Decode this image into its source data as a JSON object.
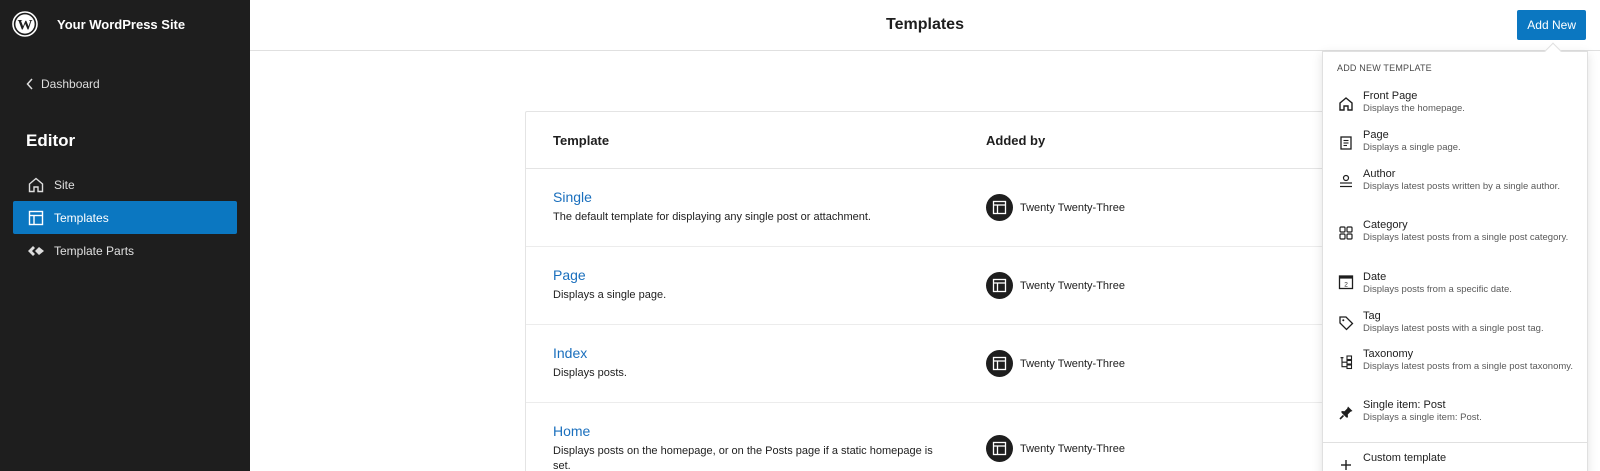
{
  "sidebar": {
    "site_name": "Your WordPress Site",
    "back_label": "Dashboard",
    "section_title": "Editor",
    "items": [
      {
        "label": "Site",
        "icon": "home-icon"
      },
      {
        "label": "Templates",
        "icon": "layout-icon"
      },
      {
        "label": "Template Parts",
        "icon": "symbol-icon"
      }
    ],
    "accent_color": "#0b77c1"
  },
  "header": {
    "title": "Templates",
    "add_new_label": "Add New"
  },
  "table": {
    "columns": [
      "Template",
      "Added by"
    ],
    "rows": [
      {
        "name": "Single",
        "description": "The default template for displaying any single post or attachment.",
        "author": "Twenty Twenty-Three"
      },
      {
        "name": "Page",
        "description": "Displays a single page.",
        "author": "Twenty Twenty-Three"
      },
      {
        "name": "Index",
        "description": "Displays posts.",
        "author": "Twenty Twenty-Three"
      },
      {
        "name": "Home",
        "description": "Displays posts on the homepage, or on the Posts page if a static homepage is set.",
        "author": "Twenty Twenty-Three"
      }
    ]
  },
  "dropdown": {
    "heading": "ADD NEW TEMPLATE",
    "items": [
      {
        "title": "Front Page",
        "description": "Displays the homepage.",
        "icon": "home-icon"
      },
      {
        "title": "Page",
        "description": "Displays a single page.",
        "icon": "page-icon"
      },
      {
        "title": "Author",
        "description": "Displays latest posts written by a single author.",
        "icon": "author-icon"
      },
      {
        "title": "Category",
        "description": "Displays latest posts from a single post category.",
        "icon": "category-icon"
      },
      {
        "title": "Date",
        "description": "Displays posts from a specific date.",
        "icon": "calendar-icon"
      },
      {
        "title": "Tag",
        "description": "Displays latest posts with a single post tag.",
        "icon": "tag-icon"
      },
      {
        "title": "Taxonomy",
        "description": "Displays latest posts from a single post taxonomy.",
        "icon": "taxonomy-icon"
      },
      {
        "title": "Single item: Post",
        "description": "Displays a single item: Post.",
        "icon": "pin-icon"
      }
    ],
    "custom_label": "Custom template"
  }
}
